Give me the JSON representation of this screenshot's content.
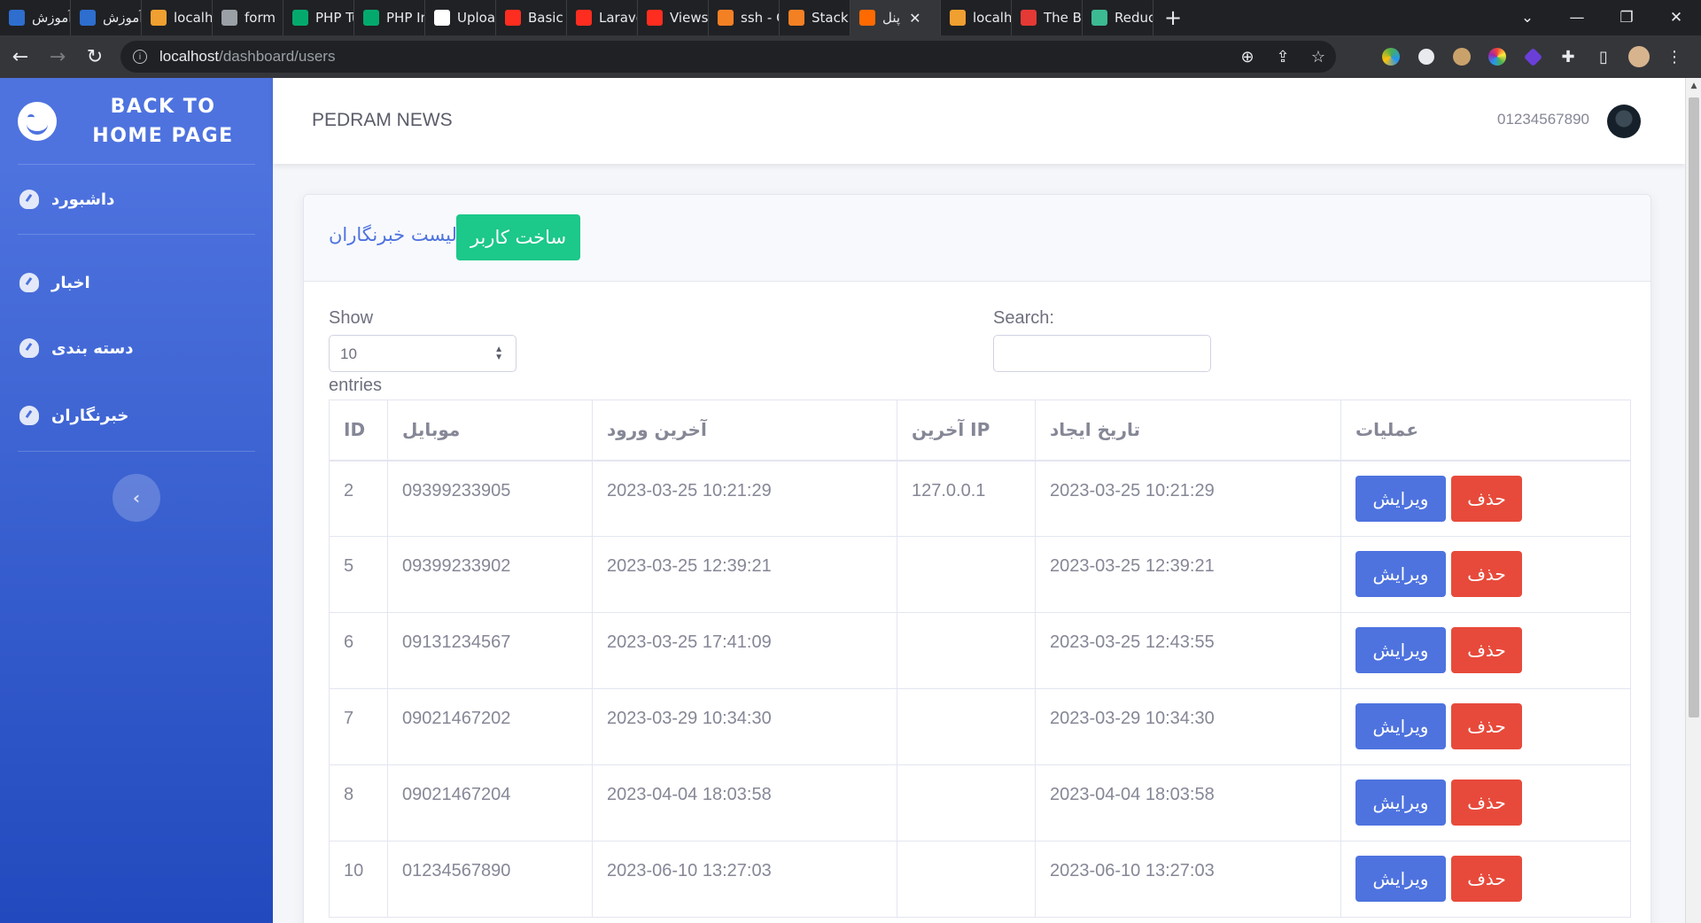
{
  "browser": {
    "tabs": [
      {
        "title": "آموزش",
        "icon": "blog-icon",
        "color": "#2d6ecf",
        "active": false
      },
      {
        "title": "آموزش",
        "icon": "blog-icon",
        "color": "#2d6ecf",
        "active": false
      },
      {
        "title": "localho",
        "icon": "laravel-forge-icon",
        "color": "#f0a030",
        "active": false
      },
      {
        "title": "form",
        "icon": "globe-icon",
        "color": "#9aa0a6",
        "active": false
      },
      {
        "title": "PHP Tu",
        "icon": "w3schools-icon",
        "color": "#04aa6d",
        "active": false
      },
      {
        "title": "PHP Int",
        "icon": "w3schools-icon",
        "color": "#04aa6d",
        "active": false
      },
      {
        "title": "Upload",
        "icon": "github-icon",
        "color": "#ffffff",
        "active": false
      },
      {
        "title": "Basic Ta",
        "icon": "laravel-icon",
        "color": "#ff2d20",
        "active": false
      },
      {
        "title": "Laravel",
        "icon": "laravel-icon",
        "color": "#ff2d20",
        "active": false
      },
      {
        "title": "Views -",
        "icon": "laravel-icon",
        "color": "#ff2d20",
        "active": false
      },
      {
        "title": "ssh - G",
        "icon": "stackoverflow-icon",
        "color": "#f48024",
        "active": false
      },
      {
        "title": "Stack C",
        "icon": "stackoverflow-icon",
        "color": "#f48024",
        "active": false
      },
      {
        "title": "پنل",
        "icon": "panel-icon",
        "color": "#ff6a00",
        "active": true
      },
      {
        "title": "localho",
        "icon": "laravel-forge-icon",
        "color": "#f0a030",
        "active": false
      },
      {
        "title": "The Be",
        "icon": "target-icon",
        "color": "#e53935",
        "active": false
      },
      {
        "title": "Reduce",
        "icon": "reduce-icon",
        "color": "#3cba92",
        "active": false
      }
    ],
    "url_host": "localhost",
    "url_path": "/dashboard/users"
  },
  "sidebar": {
    "brand_line1": "BACK TO",
    "brand_line2": "HOME PAGE",
    "items": [
      {
        "label": "داشبورد",
        "icon": "dashboard-icon"
      },
      {
        "label": "اخبار",
        "icon": "dashboard-icon"
      },
      {
        "label": "دسته بندی",
        "icon": "dashboard-icon"
      },
      {
        "label": "خبرنگاران",
        "icon": "dashboard-icon"
      }
    ],
    "toggle_glyph": "‹"
  },
  "topbar": {
    "site_title": "PEDRAM NEWS",
    "user_phone": "01234567890"
  },
  "card": {
    "title": "لیست خبرنگاران",
    "create_button": "ساخت کاربر",
    "show_label": "Show",
    "entries_label": "entries",
    "length_value": "10",
    "search_label": "Search:"
  },
  "table": {
    "headers": [
      "ID",
      "موبایل",
      "آخرین ورود",
      "آخرین IP",
      "تاریخ ایجاد",
      "عملیات"
    ],
    "edit_label": "ویرایش",
    "delete_label": "حذف",
    "rows": [
      {
        "id": "2",
        "mobile": "09399233905",
        "last_login": "2023-03-25 10:21:29",
        "last_ip": "127.0.0.1",
        "created": "2023-03-25 10:21:29"
      },
      {
        "id": "5",
        "mobile": "09399233902",
        "last_login": "2023-03-25 12:39:21",
        "last_ip": "",
        "created": "2023-03-25 12:39:21"
      },
      {
        "id": "6",
        "mobile": "09131234567",
        "last_login": "2023-03-25 17:41:09",
        "last_ip": "",
        "created": "2023-03-25 12:43:55"
      },
      {
        "id": "7",
        "mobile": "09021467202",
        "last_login": "2023-03-29 10:34:30",
        "last_ip": "",
        "created": "2023-03-29 10:34:30"
      },
      {
        "id": "8",
        "mobile": "09021467204",
        "last_login": "2023-04-04 18:03:58",
        "last_ip": "",
        "created": "2023-04-04 18:03:58"
      },
      {
        "id": "10",
        "mobile": "01234567890",
        "last_login": "2023-06-10 13:27:03",
        "last_ip": "",
        "created": "2023-06-10 13:27:03"
      }
    ]
  },
  "colors": {
    "primary": "#4e73df",
    "success": "#1cc88a",
    "danger": "#e74a3b"
  }
}
